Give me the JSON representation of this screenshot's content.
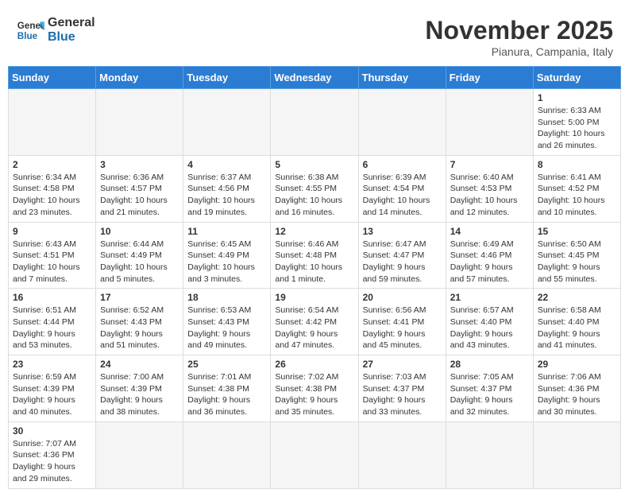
{
  "header": {
    "logo_general": "General",
    "logo_blue": "Blue",
    "month_title": "November 2025",
    "location": "Pianura, Campania, Italy"
  },
  "weekdays": [
    "Sunday",
    "Monday",
    "Tuesday",
    "Wednesday",
    "Thursday",
    "Friday",
    "Saturday"
  ],
  "weeks": [
    [
      {
        "day": "",
        "info": ""
      },
      {
        "day": "",
        "info": ""
      },
      {
        "day": "",
        "info": ""
      },
      {
        "day": "",
        "info": ""
      },
      {
        "day": "",
        "info": ""
      },
      {
        "day": "",
        "info": ""
      },
      {
        "day": "1",
        "info": "Sunrise: 6:33 AM\nSunset: 5:00 PM\nDaylight: 10 hours and 26 minutes."
      }
    ],
    [
      {
        "day": "2",
        "info": "Sunrise: 6:34 AM\nSunset: 4:58 PM\nDaylight: 10 hours and 23 minutes."
      },
      {
        "day": "3",
        "info": "Sunrise: 6:36 AM\nSunset: 4:57 PM\nDaylight: 10 hours and 21 minutes."
      },
      {
        "day": "4",
        "info": "Sunrise: 6:37 AM\nSunset: 4:56 PM\nDaylight: 10 hours and 19 minutes."
      },
      {
        "day": "5",
        "info": "Sunrise: 6:38 AM\nSunset: 4:55 PM\nDaylight: 10 hours and 16 minutes."
      },
      {
        "day": "6",
        "info": "Sunrise: 6:39 AM\nSunset: 4:54 PM\nDaylight: 10 hours and 14 minutes."
      },
      {
        "day": "7",
        "info": "Sunrise: 6:40 AM\nSunset: 4:53 PM\nDaylight: 10 hours and 12 minutes."
      },
      {
        "day": "8",
        "info": "Sunrise: 6:41 AM\nSunset: 4:52 PM\nDaylight: 10 hours and 10 minutes."
      }
    ],
    [
      {
        "day": "9",
        "info": "Sunrise: 6:43 AM\nSunset: 4:51 PM\nDaylight: 10 hours and 7 minutes."
      },
      {
        "day": "10",
        "info": "Sunrise: 6:44 AM\nSunset: 4:49 PM\nDaylight: 10 hours and 5 minutes."
      },
      {
        "day": "11",
        "info": "Sunrise: 6:45 AM\nSunset: 4:49 PM\nDaylight: 10 hours and 3 minutes."
      },
      {
        "day": "12",
        "info": "Sunrise: 6:46 AM\nSunset: 4:48 PM\nDaylight: 10 hours and 1 minute."
      },
      {
        "day": "13",
        "info": "Sunrise: 6:47 AM\nSunset: 4:47 PM\nDaylight: 9 hours and 59 minutes."
      },
      {
        "day": "14",
        "info": "Sunrise: 6:49 AM\nSunset: 4:46 PM\nDaylight: 9 hours and 57 minutes."
      },
      {
        "day": "15",
        "info": "Sunrise: 6:50 AM\nSunset: 4:45 PM\nDaylight: 9 hours and 55 minutes."
      }
    ],
    [
      {
        "day": "16",
        "info": "Sunrise: 6:51 AM\nSunset: 4:44 PM\nDaylight: 9 hours and 53 minutes."
      },
      {
        "day": "17",
        "info": "Sunrise: 6:52 AM\nSunset: 4:43 PM\nDaylight: 9 hours and 51 minutes."
      },
      {
        "day": "18",
        "info": "Sunrise: 6:53 AM\nSunset: 4:43 PM\nDaylight: 9 hours and 49 minutes."
      },
      {
        "day": "19",
        "info": "Sunrise: 6:54 AM\nSunset: 4:42 PM\nDaylight: 9 hours and 47 minutes."
      },
      {
        "day": "20",
        "info": "Sunrise: 6:56 AM\nSunset: 4:41 PM\nDaylight: 9 hours and 45 minutes."
      },
      {
        "day": "21",
        "info": "Sunrise: 6:57 AM\nSunset: 4:40 PM\nDaylight: 9 hours and 43 minutes."
      },
      {
        "day": "22",
        "info": "Sunrise: 6:58 AM\nSunset: 4:40 PM\nDaylight: 9 hours and 41 minutes."
      }
    ],
    [
      {
        "day": "23",
        "info": "Sunrise: 6:59 AM\nSunset: 4:39 PM\nDaylight: 9 hours and 40 minutes."
      },
      {
        "day": "24",
        "info": "Sunrise: 7:00 AM\nSunset: 4:39 PM\nDaylight: 9 hours and 38 minutes."
      },
      {
        "day": "25",
        "info": "Sunrise: 7:01 AM\nSunset: 4:38 PM\nDaylight: 9 hours and 36 minutes."
      },
      {
        "day": "26",
        "info": "Sunrise: 7:02 AM\nSunset: 4:38 PM\nDaylight: 9 hours and 35 minutes."
      },
      {
        "day": "27",
        "info": "Sunrise: 7:03 AM\nSunset: 4:37 PM\nDaylight: 9 hours and 33 minutes."
      },
      {
        "day": "28",
        "info": "Sunrise: 7:05 AM\nSunset: 4:37 PM\nDaylight: 9 hours and 32 minutes."
      },
      {
        "day": "29",
        "info": "Sunrise: 7:06 AM\nSunset: 4:36 PM\nDaylight: 9 hours and 30 minutes."
      }
    ],
    [
      {
        "day": "30",
        "info": "Sunrise: 7:07 AM\nSunset: 4:36 PM\nDaylight: 9 hours and 29 minutes."
      },
      {
        "day": "",
        "info": ""
      },
      {
        "day": "",
        "info": ""
      },
      {
        "day": "",
        "info": ""
      },
      {
        "day": "",
        "info": ""
      },
      {
        "day": "",
        "info": ""
      },
      {
        "day": "",
        "info": ""
      }
    ]
  ]
}
